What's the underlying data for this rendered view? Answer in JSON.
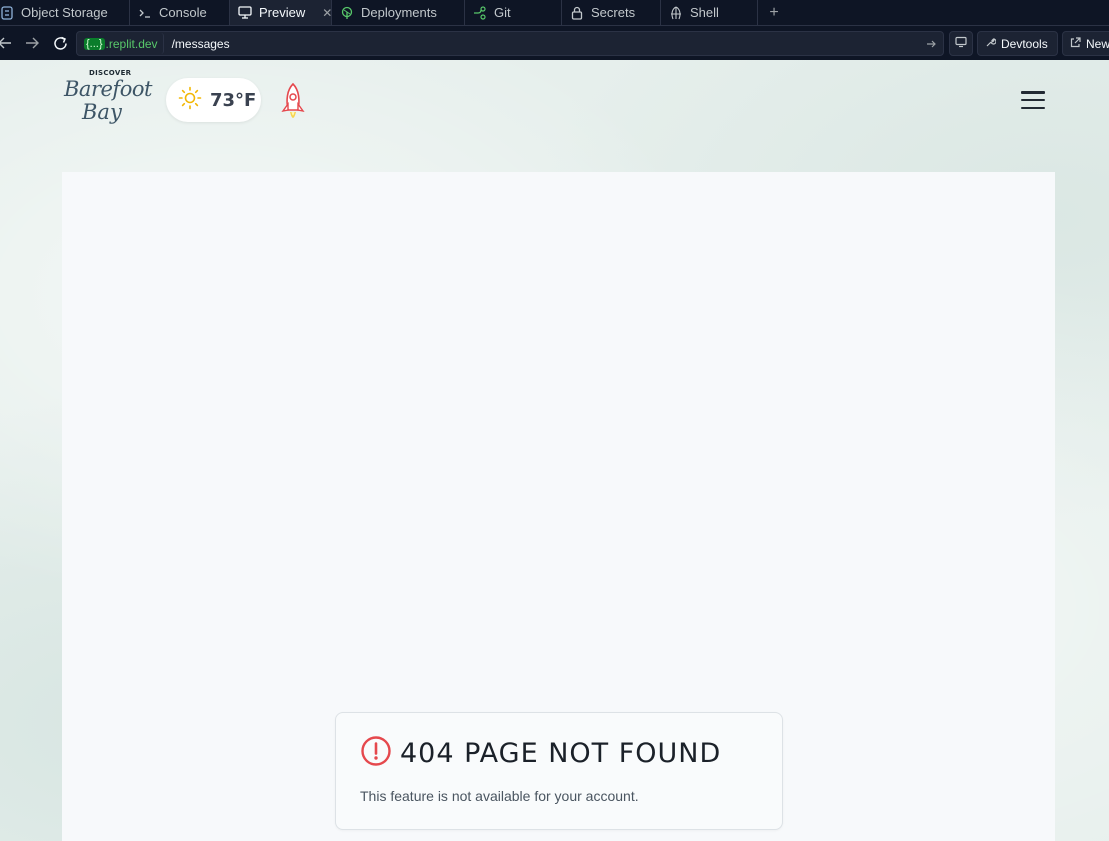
{
  "tabs": [
    {
      "label": "Object Storage",
      "icon": "storage-icon",
      "active": false
    },
    {
      "label": "Console",
      "icon": "terminal-icon",
      "active": false
    },
    {
      "label": "Preview",
      "icon": "monitor-icon",
      "active": true
    },
    {
      "label": "Deployments",
      "icon": "deploy-icon",
      "active": false
    },
    {
      "label": "Git",
      "icon": "git-branch-icon",
      "active": false
    },
    {
      "label": "Secrets",
      "icon": "lock-icon",
      "active": false
    },
    {
      "label": "Shell",
      "icon": "shell-icon",
      "active": false
    }
  ],
  "urlbar": {
    "domain_brace": "{...}",
    "domain": ".replit.dev",
    "path": "/messages",
    "devtools_label": "Devtools",
    "newtab_label": "New"
  },
  "app": {
    "logo": {
      "top": "DISCOVER",
      "line1": "Barefoot",
      "line2": "Bay"
    },
    "weather": {
      "temperature": "73°F",
      "icon": "sun-icon"
    },
    "error": {
      "title": "404 Page Not Found",
      "message": "This feature is not available for your account."
    }
  },
  "colors": {
    "editor_bg": "#0e1525",
    "accent_green": "#58c86a",
    "error_red": "#e5484d",
    "page_bg": "#e6efec"
  }
}
